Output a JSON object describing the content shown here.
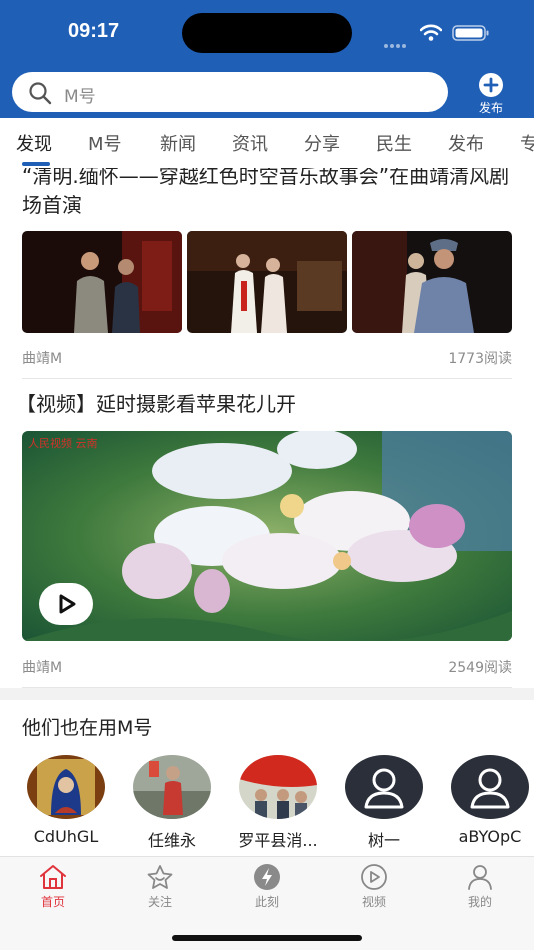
{
  "status_bar": {
    "time": "09:17"
  },
  "search": {
    "placeholder": "M号"
  },
  "publish": {
    "label": "发布"
  },
  "tabs": [
    {
      "label": "发现",
      "active": true
    },
    {
      "label": "M号"
    },
    {
      "label": "新闻"
    },
    {
      "label": "资讯"
    },
    {
      "label": "分享"
    },
    {
      "label": "民生"
    },
    {
      "label": "发布"
    },
    {
      "label": "专"
    }
  ],
  "articles": [
    {
      "title": "“清明.缅怀——穿越红色时空音乐故事会”在曲靖清风剧场首演",
      "source": "曲靖M",
      "reads": "1773阅读"
    },
    {
      "title": "【视频】延时摄影看苹果花儿开",
      "source": "曲靖M",
      "reads": "2549阅读",
      "watermark": "人民视频 云南"
    }
  ],
  "users_section": {
    "heading": "他们也在用M号",
    "users": [
      {
        "name": "CdUhGL"
      },
      {
        "name": "任维永"
      },
      {
        "name": "罗平县消..."
      },
      {
        "name": "树一"
      },
      {
        "name": "aBYOpC"
      }
    ]
  },
  "bottom_nav": [
    {
      "label": "首页",
      "icon": "home-icon",
      "active": true
    },
    {
      "label": "关注",
      "icon": "star-icon"
    },
    {
      "label": "此刻",
      "icon": "lightning-icon"
    },
    {
      "label": "视频",
      "icon": "play-icon"
    },
    {
      "label": "我的",
      "icon": "user-icon"
    }
  ],
  "colors": {
    "brand_blue": "#1f5fb6",
    "active_red": "#e0343d"
  }
}
